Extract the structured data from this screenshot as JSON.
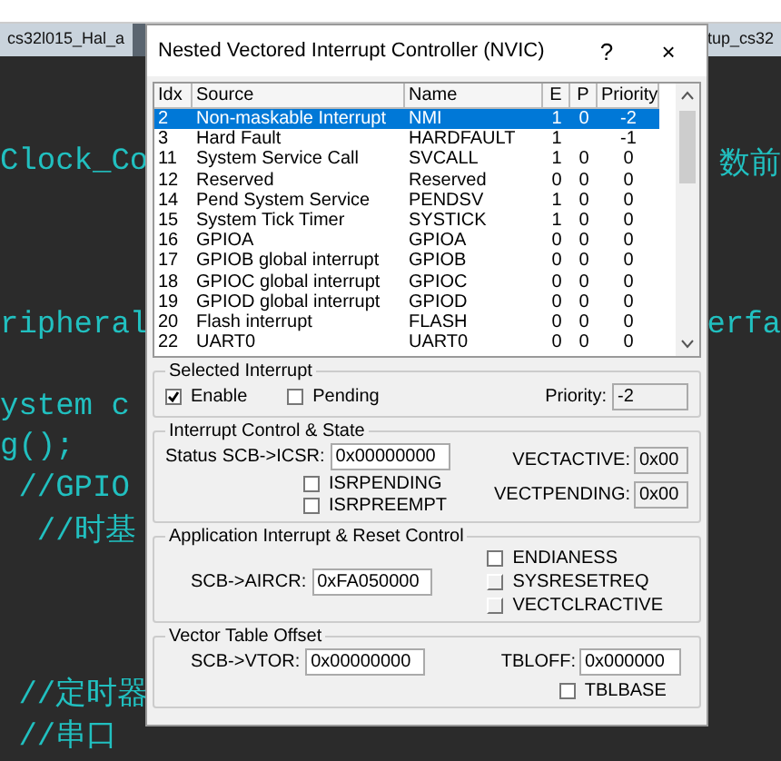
{
  "editor": {
    "tabs": [
      {
        "label": "cs32l015_Hal_a",
        "selected": false
      },
      {
        "label": "tup_cs32",
        "selected": false
      }
    ],
    "sections": [
      {
        "lines": [
          {
            "left": "Clock_Co",
            "right": "数前"
          }
        ]
      },
      {
        "lines": [
          {
            "left": "ripheral",
            "right": "erfa"
          }
        ]
      },
      {
        "lines": [
          {
            "left": "ystem c"
          },
          {
            "left": "g();"
          },
          {
            "left": " //GPIO"
          },
          {
            "left": "  //时基"
          }
        ]
      },
      {
        "lines": [
          {
            "left": " //定时器"
          },
          {
            "left": " //串口"
          }
        ]
      }
    ]
  },
  "dialog": {
    "title": "Nested Vectored Interrupt Controller (NVIC)",
    "help": "?",
    "close": "×",
    "table": {
      "columns": [
        "Idx",
        "Source",
        "Name",
        "E",
        "P",
        "Priority"
      ],
      "rows": [
        {
          "cells": [
            "2",
            "Non-maskable Interrupt",
            "NMI",
            "1",
            "0",
            "-2"
          ],
          "selected": true
        },
        {
          "cells": [
            "3",
            "Hard Fault",
            "HARDFAULT",
            "1",
            "",
            "-1"
          ],
          "selected": false
        },
        {
          "cells": [
            "11",
            "System Service Call",
            "SVCALL",
            "1",
            "0",
            "0"
          ],
          "selected": false
        },
        {
          "cells": [
            "12",
            "Reserved",
            "Reserved",
            "0",
            "0",
            "0"
          ],
          "selected": false
        },
        {
          "cells": [
            "14",
            "Pend System Service",
            "PENDSV",
            "1",
            "0",
            "0"
          ],
          "selected": false
        },
        {
          "cells": [
            "15",
            "System Tick Timer",
            "SYSTICK",
            "1",
            "0",
            "0"
          ],
          "selected": false
        },
        {
          "cells": [
            "16",
            "GPIOA",
            "GPIOA",
            "0",
            "0",
            "0"
          ],
          "selected": false
        },
        {
          "cells": [
            "17",
            "GPIOB global interrupt",
            "GPIOB",
            "0",
            "0",
            "0"
          ],
          "selected": false
        },
        {
          "cells": [
            "18",
            "GPIOC global interrupt",
            "GPIOC",
            "0",
            "0",
            "0"
          ],
          "selected": false
        },
        {
          "cells": [
            "19",
            "GPIOD global interrupt",
            "GPIOD",
            "0",
            "0",
            "0"
          ],
          "selected": false
        },
        {
          "cells": [
            "20",
            "Flash interrupt",
            "FLASH",
            "0",
            "0",
            "0"
          ],
          "selected": false
        },
        {
          "cells": [
            "22",
            "UART0",
            "UART0",
            "0",
            "0",
            "0"
          ],
          "selected": false
        }
      ]
    },
    "selected_interrupt": {
      "title": "Selected Interrupt",
      "enable": {
        "label": "Enable",
        "checked": true
      },
      "pending": {
        "label": "Pending",
        "checked": false
      },
      "priority": {
        "label": "Priority:",
        "value": "-2",
        "readonly": true
      }
    },
    "control_state": {
      "title": "Interrupt Control & State",
      "status": "Status",
      "icsr": {
        "label": "SCB->ICSR:",
        "value": "0x00000000",
        "readonly": false
      },
      "checks": [
        {
          "label": "ISRPENDING",
          "checked": false
        },
        {
          "label": "ISRPREEMPT",
          "checked": false
        }
      ],
      "vectactive": {
        "label": "VECTACTIVE:",
        "value": "0x00",
        "readonly": true
      },
      "vectpending": {
        "label": "VECTPENDING:",
        "value": "0x00",
        "readonly": true
      }
    },
    "reset_control": {
      "title": "Application Interrupt & Reset Control",
      "aircr": {
        "label": "SCB->AIRCR:",
        "value": "0xFA050000",
        "readonly": false
      },
      "checks": [
        {
          "label": "ENDIANESS",
          "checked": false,
          "kind": "checkbox"
        },
        {
          "label": "SYSRESETREQ",
          "checked": false,
          "kind": "raised"
        },
        {
          "label": "VECTCLRACTIVE",
          "checked": false,
          "kind": "raised"
        }
      ]
    },
    "vector_table": {
      "title": "Vector Table Offset",
      "vtor": {
        "label": "SCB->VTOR:",
        "value": "0x00000000",
        "readonly": false
      },
      "tbloff": {
        "label": "TBLOFF:",
        "value": "0x000000",
        "readonly": false
      },
      "checks": [
        {
          "label": "TBLBASE",
          "checked": false
        }
      ]
    }
  }
}
